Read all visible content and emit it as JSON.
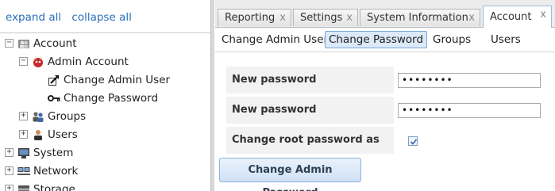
{
  "tree_links": {
    "expand_all": "expand all",
    "collapse_all": "collapse all"
  },
  "tree": [
    {
      "label": "Account",
      "toggle": "−",
      "icon": "users-group-icon"
    },
    {
      "label": "Admin Account",
      "toggle": "−",
      "icon": "bsd-daemon-icon"
    },
    {
      "label": "Change Admin User",
      "toggle": "",
      "icon": "edit-arrow-icon"
    },
    {
      "label": "Change Password",
      "toggle": "",
      "icon": "key-icon"
    },
    {
      "label": "Groups",
      "toggle": "+",
      "icon": "group-icon"
    },
    {
      "label": "Users",
      "toggle": "+",
      "icon": "user-icon"
    },
    {
      "label": "System",
      "toggle": "+",
      "icon": "system-icon"
    },
    {
      "label": "Network",
      "toggle": "+",
      "icon": "network-icon"
    },
    {
      "label": "Storage",
      "toggle": "+",
      "icon": "storage-icon"
    }
  ],
  "tabs": [
    {
      "label": "Reporting",
      "close": "x"
    },
    {
      "label": "Settings",
      "close": "x"
    },
    {
      "label": "System Information",
      "close": "x"
    },
    {
      "label": "Account",
      "close": "x"
    }
  ],
  "subtabs": [
    "Change Admin User",
    "Change Password",
    "Groups",
    "Users"
  ],
  "form": {
    "new_password_label": "New password",
    "new_password_value": "••••••••",
    "confirm_label": "New password confirmation",
    "confirm_value": "••••••••",
    "root_label": "Change root password as well",
    "root_checked": true,
    "submit_label": "Change Admin Password"
  },
  "colors": {
    "link": "#2a6ebb",
    "active_subtab_bg": "#dbe9f8",
    "active_subtab_border": "#7aa6da"
  }
}
